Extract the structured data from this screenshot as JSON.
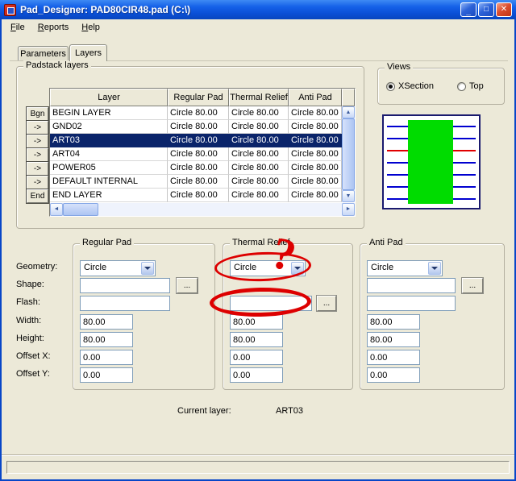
{
  "window": {
    "title": "Pad_Designer: PAD80CIR48.pad (C:\\)",
    "minimize_glyph": "_",
    "maximize_glyph": "□",
    "close_glyph": "✕"
  },
  "menu": {
    "items": [
      "File",
      "Reports",
      "Help"
    ]
  },
  "tabs": {
    "parameters": "Parameters",
    "layers": "Layers"
  },
  "padstack": {
    "title": "Padstack layers",
    "columns": [
      "Layer",
      "Regular Pad",
      "Thermal Relief",
      "Anti Pad"
    ],
    "rows": [
      {
        "button": "Bgn",
        "layer": "BEGIN LAYER",
        "regular": "Circle 80.00",
        "thermal": "Circle 80.00",
        "anti": "Circle 80.00",
        "selected": false
      },
      {
        "button": "->",
        "layer": "GND02",
        "regular": "Circle 80.00",
        "thermal": "Circle 80.00",
        "anti": "Circle 80.00",
        "selected": false
      },
      {
        "button": "->",
        "layer": "ART03",
        "regular": "Circle 80.00",
        "thermal": "Circle 80.00",
        "anti": "Circle 80.00",
        "selected": true
      },
      {
        "button": "->",
        "layer": "ART04",
        "regular": "Circle 80.00",
        "thermal": "Circle 80.00",
        "anti": "Circle 80.00",
        "selected": false
      },
      {
        "button": "->",
        "layer": "POWER05",
        "regular": "Circle 80.00",
        "thermal": "Circle 80.00",
        "anti": "Circle 80.00",
        "selected": false
      },
      {
        "button": "->",
        "layer": "DEFAULT INTERNAL",
        "regular": "Circle 80.00",
        "thermal": "Circle 80.00",
        "anti": "Circle 80.00",
        "selected": false
      },
      {
        "button": "End",
        "layer": "END LAYER",
        "regular": "Circle 80.00",
        "thermal": "Circle 80.00",
        "anti": "Circle 80.00",
        "selected": false
      }
    ]
  },
  "views": {
    "title": "Views",
    "options": [
      {
        "label": "XSection",
        "selected": true
      },
      {
        "label": "Top",
        "selected": false
      }
    ]
  },
  "labels": {
    "geometry": "Geometry:",
    "shape": "Shape:",
    "flash": "Flash:",
    "width": "Width:",
    "height": "Height:",
    "offset_x": "Offset X:",
    "offset_y": "Offset Y:"
  },
  "buttons": {
    "browse": "..."
  },
  "regular_pad": {
    "title": "Regular Pad",
    "geometry": "Circle",
    "shape": "",
    "flash": "",
    "width": "80.00",
    "height": "80.00",
    "offset_x": "0.00",
    "offset_y": "0.00"
  },
  "thermal_relief": {
    "title": "Thermal Relief",
    "geometry": "Circle",
    "flash": "",
    "width": "80.00",
    "height": "80.00",
    "offset_x": "0.00",
    "offset_y": "0.00"
  },
  "anti_pad": {
    "title": "Anti Pad",
    "geometry": "Circle",
    "shape": "",
    "flash": "",
    "width": "80.00",
    "height": "80.00",
    "offset_x": "0.00",
    "offset_y": "0.00"
  },
  "current_layer": {
    "label": "Current layer:",
    "value": "ART03"
  },
  "annotations": {
    "question_mark": "?",
    "accent_color": "#DD0000"
  },
  "colors": {
    "titlebar": "#1561E8",
    "selection": "#0A246A",
    "pad_preview": "#00DC00",
    "layer_line": "#0000D0",
    "highlight_line": "#E00000"
  }
}
